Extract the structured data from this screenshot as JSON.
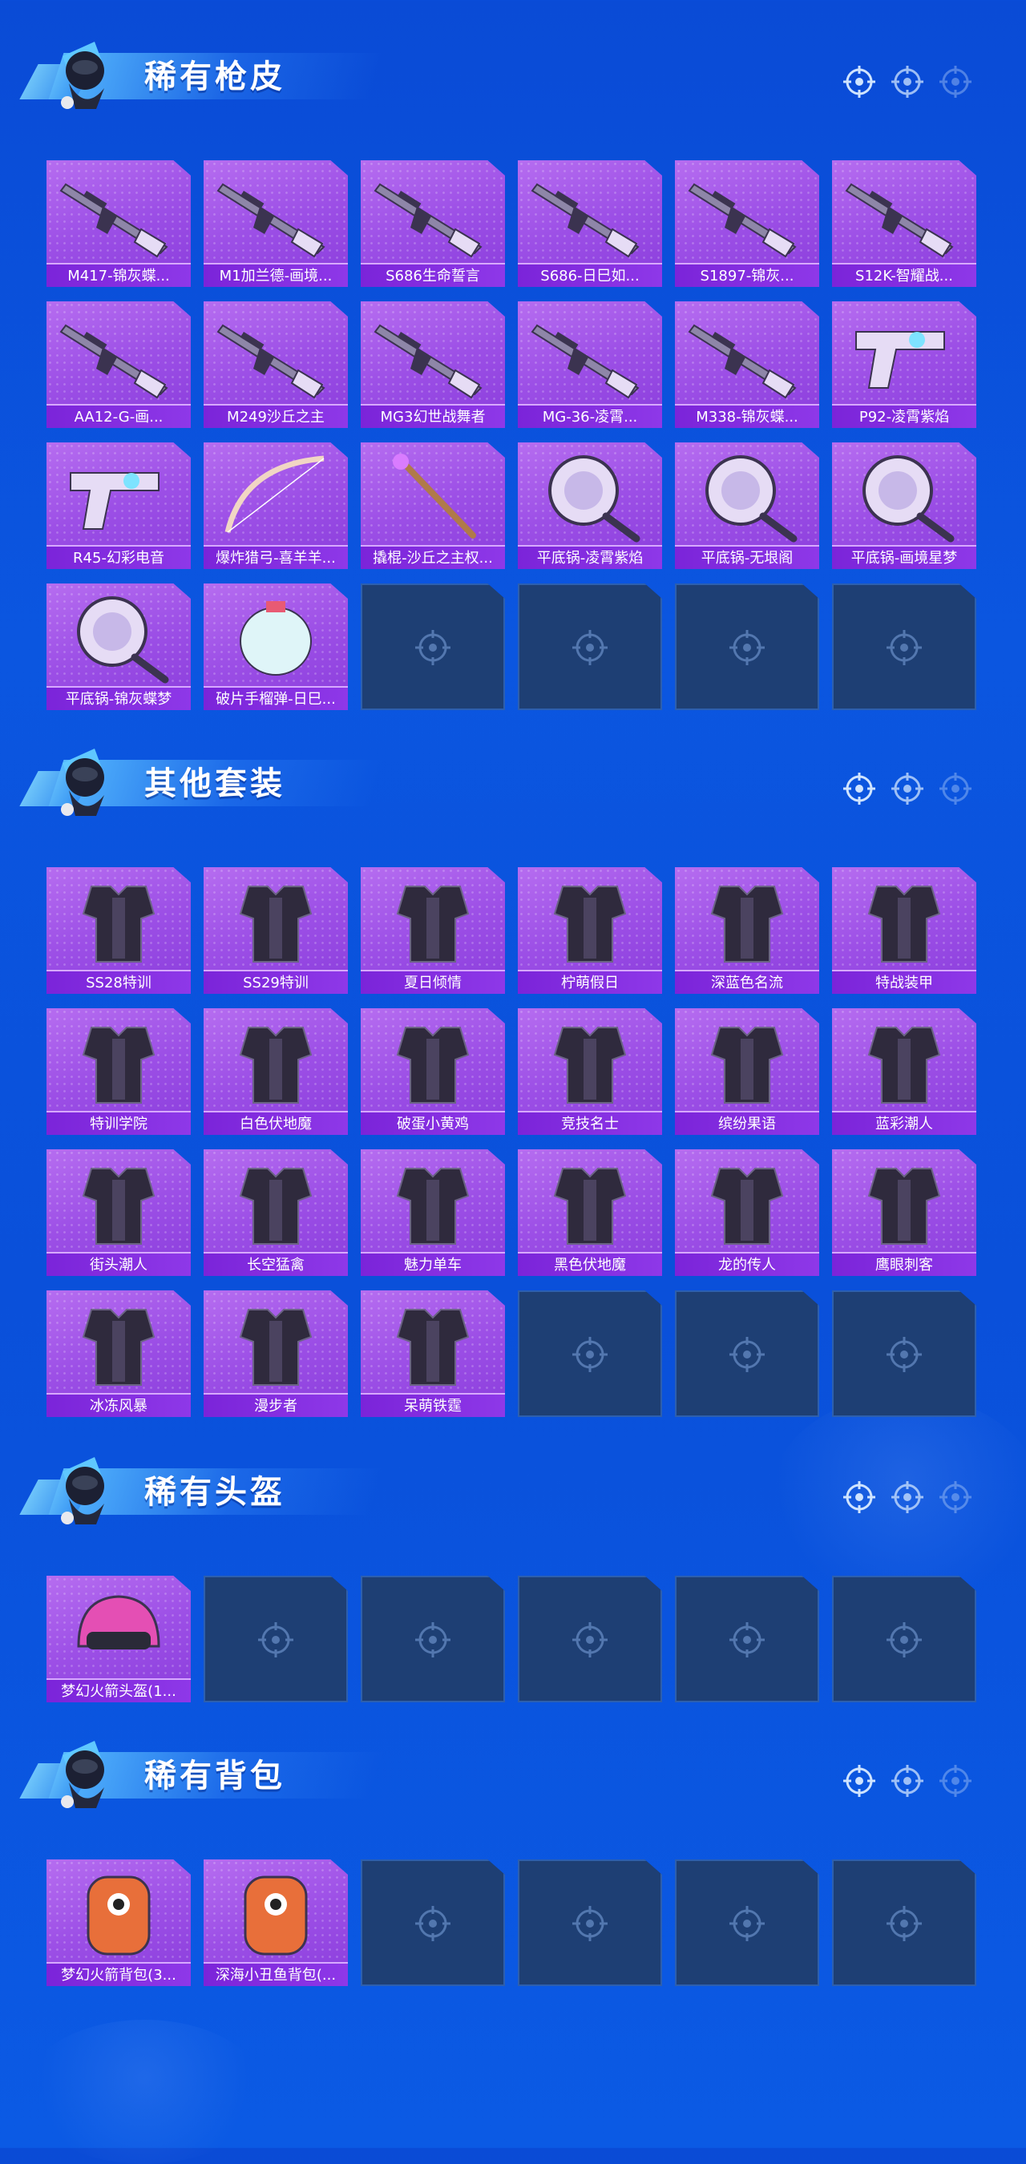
{
  "colors": {
    "background": "#0b52dc",
    "card_purple": "#a257e9",
    "card_label": "#8530e2",
    "card_empty": "#1e3f74",
    "title_text": "#ffffff"
  },
  "sections": [
    {
      "title": "稀有枪皮",
      "items": [
        {
          "label": "M417-锦灰蝶...",
          "icon": "rifle-icon"
        },
        {
          "label": "M1加兰德-画境...",
          "icon": "rifle-icon"
        },
        {
          "label": "S686生命誓言",
          "icon": "shotgun-icon"
        },
        {
          "label": "S686-日巳如...",
          "icon": "shotgun-icon"
        },
        {
          "label": "S1897-锦灰...",
          "icon": "shotgun-icon"
        },
        {
          "label": "S12K-智耀战...",
          "icon": "shotgun-icon"
        },
        {
          "label": "AA12-G-画...",
          "icon": "shotgun-icon"
        },
        {
          "label": "M249沙丘之主",
          "icon": "machine-gun-icon"
        },
        {
          "label": "MG3幻世战舞者",
          "icon": "machine-gun-icon"
        },
        {
          "label": "MG-36-凌霄...",
          "icon": "rifle-icon"
        },
        {
          "label": "M338-锦灰蝶...",
          "icon": "rifle-icon"
        },
        {
          "label": "P92-凌霄紫焰",
          "icon": "pistol-icon"
        },
        {
          "label": "R45-幻彩电音",
          "icon": "revolver-icon"
        },
        {
          "label": "爆炸猎弓-喜羊羊...",
          "icon": "bow-icon"
        },
        {
          "label": "撬棍-沙丘之主权...",
          "icon": "crowbar-icon"
        },
        {
          "label": "平底锅-凌霄紫焰",
          "icon": "pan-icon"
        },
        {
          "label": "平底锅-无垠阁",
          "icon": "pan-icon"
        },
        {
          "label": "平底锅-画境星梦",
          "icon": "pan-icon"
        },
        {
          "label": "平底锅-锦灰蝶梦",
          "icon": "pan-icon"
        },
        {
          "label": "破片手榴弹-日巳...",
          "icon": "grenade-icon"
        }
      ],
      "empty_slots": 4
    },
    {
      "title": "其他套装",
      "items": [
        {
          "label": "SS28特训",
          "icon": "outfit-icon"
        },
        {
          "label": "SS29特训",
          "icon": "outfit-icon"
        },
        {
          "label": "夏日倾情",
          "icon": "outfit-icon"
        },
        {
          "label": "柠萌假日",
          "icon": "outfit-icon"
        },
        {
          "label": "深蓝色名流",
          "icon": "outfit-icon"
        },
        {
          "label": "特战装甲",
          "icon": "outfit-icon"
        },
        {
          "label": "特训学院",
          "icon": "outfit-icon"
        },
        {
          "label": "白色伏地魔",
          "icon": "outfit-icon"
        },
        {
          "label": "破蛋小黄鸡",
          "icon": "outfit-icon"
        },
        {
          "label": "竞技名士",
          "icon": "outfit-icon"
        },
        {
          "label": "缤纷果语",
          "icon": "outfit-icon"
        },
        {
          "label": "蓝彩潮人",
          "icon": "outfit-icon"
        },
        {
          "label": "街头潮人",
          "icon": "outfit-icon"
        },
        {
          "label": "长空猛禽",
          "icon": "outfit-icon"
        },
        {
          "label": "魅力单车",
          "icon": "outfit-icon"
        },
        {
          "label": "黑色伏地魔",
          "icon": "outfit-icon"
        },
        {
          "label": "龙的传人",
          "icon": "outfit-icon"
        },
        {
          "label": "鹰眼刺客",
          "icon": "outfit-icon"
        },
        {
          "label": "冰冻风暴",
          "icon": "outfit-icon"
        },
        {
          "label": "漫步者",
          "icon": "outfit-icon"
        },
        {
          "label": "呆萌铁霆",
          "icon": "outfit-icon"
        }
      ],
      "empty_slots": 3
    },
    {
      "title": "稀有头盔",
      "items": [
        {
          "label": "梦幻火箭头盔(1...",
          "icon": "helmet-icon"
        }
      ],
      "empty_slots": 5
    },
    {
      "title": "稀有背包",
      "items": [
        {
          "label": "梦幻火箭背包(3...",
          "icon": "backpack-icon"
        },
        {
          "label": "深海小丑鱼背包(...",
          "icon": "backpack-icon"
        }
      ],
      "empty_slots": 4
    }
  ]
}
